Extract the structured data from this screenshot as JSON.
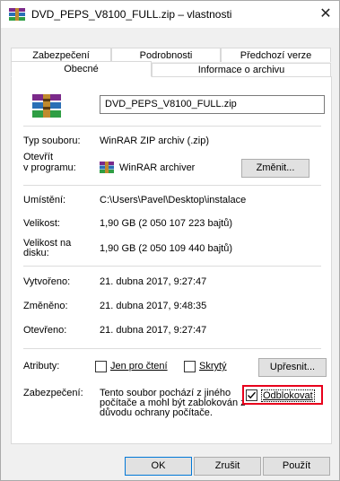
{
  "window": {
    "title": "DVD_PEPS_V8100_FULL.zip – vlastnosti",
    "close_glyph": "✕"
  },
  "tabs": {
    "row1": [
      "Zabezpečení",
      "Podrobnosti",
      "Předchozí verze"
    ],
    "row2": [
      "Obecné",
      "Informace o archivu"
    ],
    "active": "Obecné"
  },
  "general": {
    "file_name": "DVD_PEPS_V8100_FULL.zip",
    "type_label": "Typ souboru:",
    "type_value": "WinRAR ZIP archiv (.zip)",
    "opens_with_label_1": "Otevřít",
    "opens_with_label_2": "v programu:",
    "opens_with_value": "WinRAR archiver",
    "change_button": "Změnit...",
    "location_label": "Umístění:",
    "location_value": "C:\\Users\\Pavel\\Desktop\\instalace",
    "size_label": "Velikost:",
    "size_value": "1,90 GB (2 050 107 223 bajtů)",
    "size_on_disk_label_1": "Velikost na",
    "size_on_disk_label_2": "disku:",
    "size_on_disk_value": "1,90 GB (2 050 109 440 bajtů)",
    "created_label": "Vytvořeno:",
    "created_value": "21. dubna 2017, 9:27:47",
    "modified_label": "Změněno:",
    "modified_value": "21. dubna 2017, 9:48:35",
    "accessed_label": "Otevřeno:",
    "accessed_value": "21. dubna 2017, 9:27:47",
    "attributes_label": "Atributy:",
    "readonly_label": "Jen pro čtení",
    "readonly_checked": false,
    "hidden_label": "Skrytý",
    "hidden_checked": false,
    "advanced_button": "Upřesnit...",
    "security_label": "Zabezpečení:",
    "security_text_1": "Tento soubor pochází z jiného",
    "security_text_2": "počítače a mohl být zablokován z",
    "security_text_3": "důvodu ochrany počítače.",
    "unblock_label": "Odblokovat",
    "unblock_checked": true
  },
  "footer": {
    "ok": "OK",
    "cancel": "Zrušit",
    "apply": "Použít"
  },
  "colors": {
    "highlight": "#e8001c",
    "accent_border": "#0078d7"
  },
  "icons": {
    "title": "winrar-archive-icon",
    "file": "winrar-archive-icon",
    "program": "winrar-archiver-icon"
  }
}
